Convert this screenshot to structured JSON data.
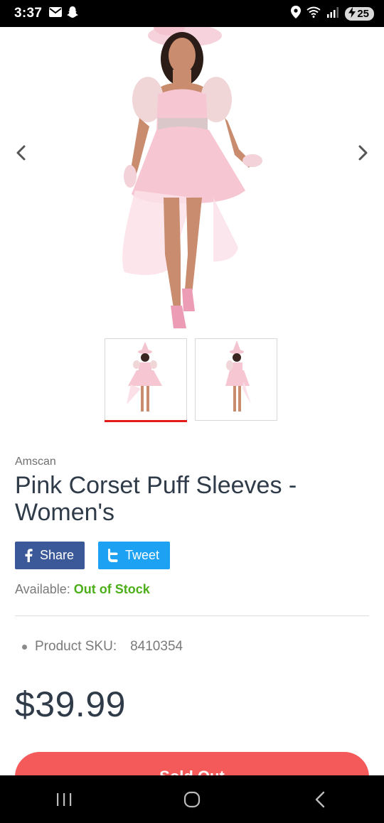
{
  "status_bar": {
    "time": "3:37",
    "battery_level": "25",
    "icons": [
      "mail-icon",
      "snapchat-icon",
      "location-icon",
      "wifi-icon",
      "signal-icon",
      "battery-charging-icon"
    ]
  },
  "gallery": {
    "prev_icon": "chevron-left-icon",
    "next_icon": "chevron-right-icon",
    "main_image": "pink-witch-costume-front-photo",
    "thumbnails": [
      {
        "image": "pink-witch-costume-front-thumbnail",
        "active": true
      },
      {
        "image": "pink-witch-costume-side-thumbnail",
        "active": false
      }
    ]
  },
  "product": {
    "brand": "Amscan",
    "title": "Pink Corset Puff Sleeves - Women's",
    "availability_label": "Available:",
    "availability_value": "Out of Stock",
    "sku_label": "Product SKU:",
    "sku_value": "8410354",
    "price": "$39.99"
  },
  "share": {
    "facebook_label": "Share",
    "twitter_label": "Tweet"
  },
  "buy_button": {
    "label": "Sold Out"
  },
  "colors": {
    "title": "#2f3b48",
    "in_stock_green": "#4caf19",
    "facebook": "#3b5998",
    "twitter": "#1da1f2",
    "sold_out_button": "#f55a5a",
    "active_thumb_underline": "#e31b1b"
  },
  "nav_bar": {
    "icons": [
      "recent-apps-icon",
      "home-icon",
      "back-icon"
    ]
  }
}
